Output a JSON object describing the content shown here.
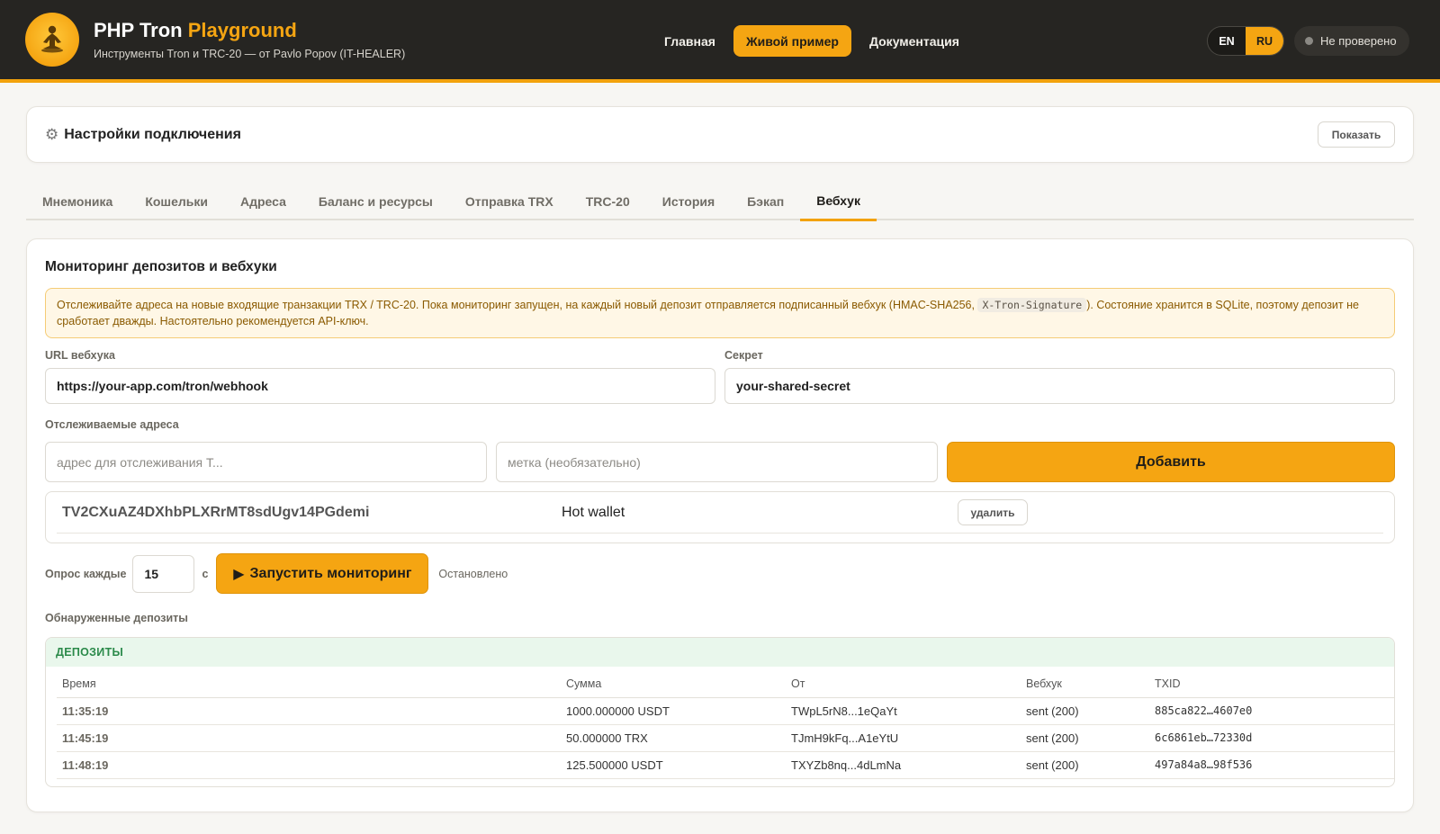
{
  "header": {
    "brand_main": "PHP Tron",
    "brand_accent": "Playground",
    "subtitle": "Инструменты Tron и TRC-20 — от Pavlo Popov (IT-HEALER)",
    "nav": [
      {
        "label": "Главная"
      },
      {
        "label": "Живой пример"
      },
      {
        "label": "Документация"
      }
    ],
    "lang": {
      "en": "EN",
      "ru": "RU"
    },
    "status": "Не проверено"
  },
  "connection": {
    "title": "Настройки подключения",
    "show_button": "Показать"
  },
  "tabs": [
    {
      "label": "Мнемоника"
    },
    {
      "label": "Кошельки"
    },
    {
      "label": "Адреса"
    },
    {
      "label": "Баланс и ресурсы"
    },
    {
      "label": "Отправка TRX"
    },
    {
      "label": "TRC-20"
    },
    {
      "label": "История"
    },
    {
      "label": "Бэкап"
    },
    {
      "label": "Вебхук"
    }
  ],
  "webhook": {
    "title": "Мониторинг депозитов и вебхуки",
    "notice_before": "Отслеживайте адреса на новые входящие транзакции TRX / TRC-20. Пока мониторинг запущен, на каждый новый депозит отправляется подписанный вебхук (HMAC-SHA256,",
    "notice_code": "X-Tron-Signature",
    "notice_after": "). Состояние хранится в SQLite, поэтому депозит не сработает дважды. Настоятельно рекомендуется API-ключ.",
    "url_label": "URL вебхука",
    "url_value": "https://your-app.com/tron/webhook",
    "secret_label": "Секрет",
    "secret_value": "your-shared-secret",
    "watched_label": "Отслеживаемые адреса",
    "address_placeholder": "адрес для отслеживания T...",
    "label_placeholder": "метка (необязательно)",
    "add_button": "Добавить",
    "watched": [
      {
        "address": "TV2CXuAZ4DXhbPLXRrMT8sdUgv14PGdemi",
        "label": "Hot wallet",
        "delete": "удалить"
      }
    ],
    "poll_label": "Опрос каждые",
    "poll_value": "15",
    "poll_unit": "с",
    "start_button": "Запустить мониторинг",
    "monitor_status": "Остановлено",
    "deposits_label": "Обнаруженные депозиты",
    "deposits_header": "ДЕПОЗИТЫ",
    "columns": [
      "Время",
      "Сумма",
      "От",
      "Вебхук",
      "TXID"
    ],
    "rows": [
      {
        "time": "11:35:19",
        "amount": "1000.000000 USDT",
        "from": "TWpL5rN8...1eQaYt",
        "webhook": "sent (200)",
        "txid": "885ca822…4607e0"
      },
      {
        "time": "11:45:19",
        "amount": "50.000000 TRX",
        "from": "TJmH9kFq...A1eYtU",
        "webhook": "sent (200)",
        "txid": "6c6861eb…72330d"
      },
      {
        "time": "11:48:19",
        "amount": "125.500000 USDT",
        "from": "TXYZb8nq...4dLmNa",
        "webhook": "sent (200)",
        "txid": "497a84a8…98f536"
      }
    ]
  }
}
